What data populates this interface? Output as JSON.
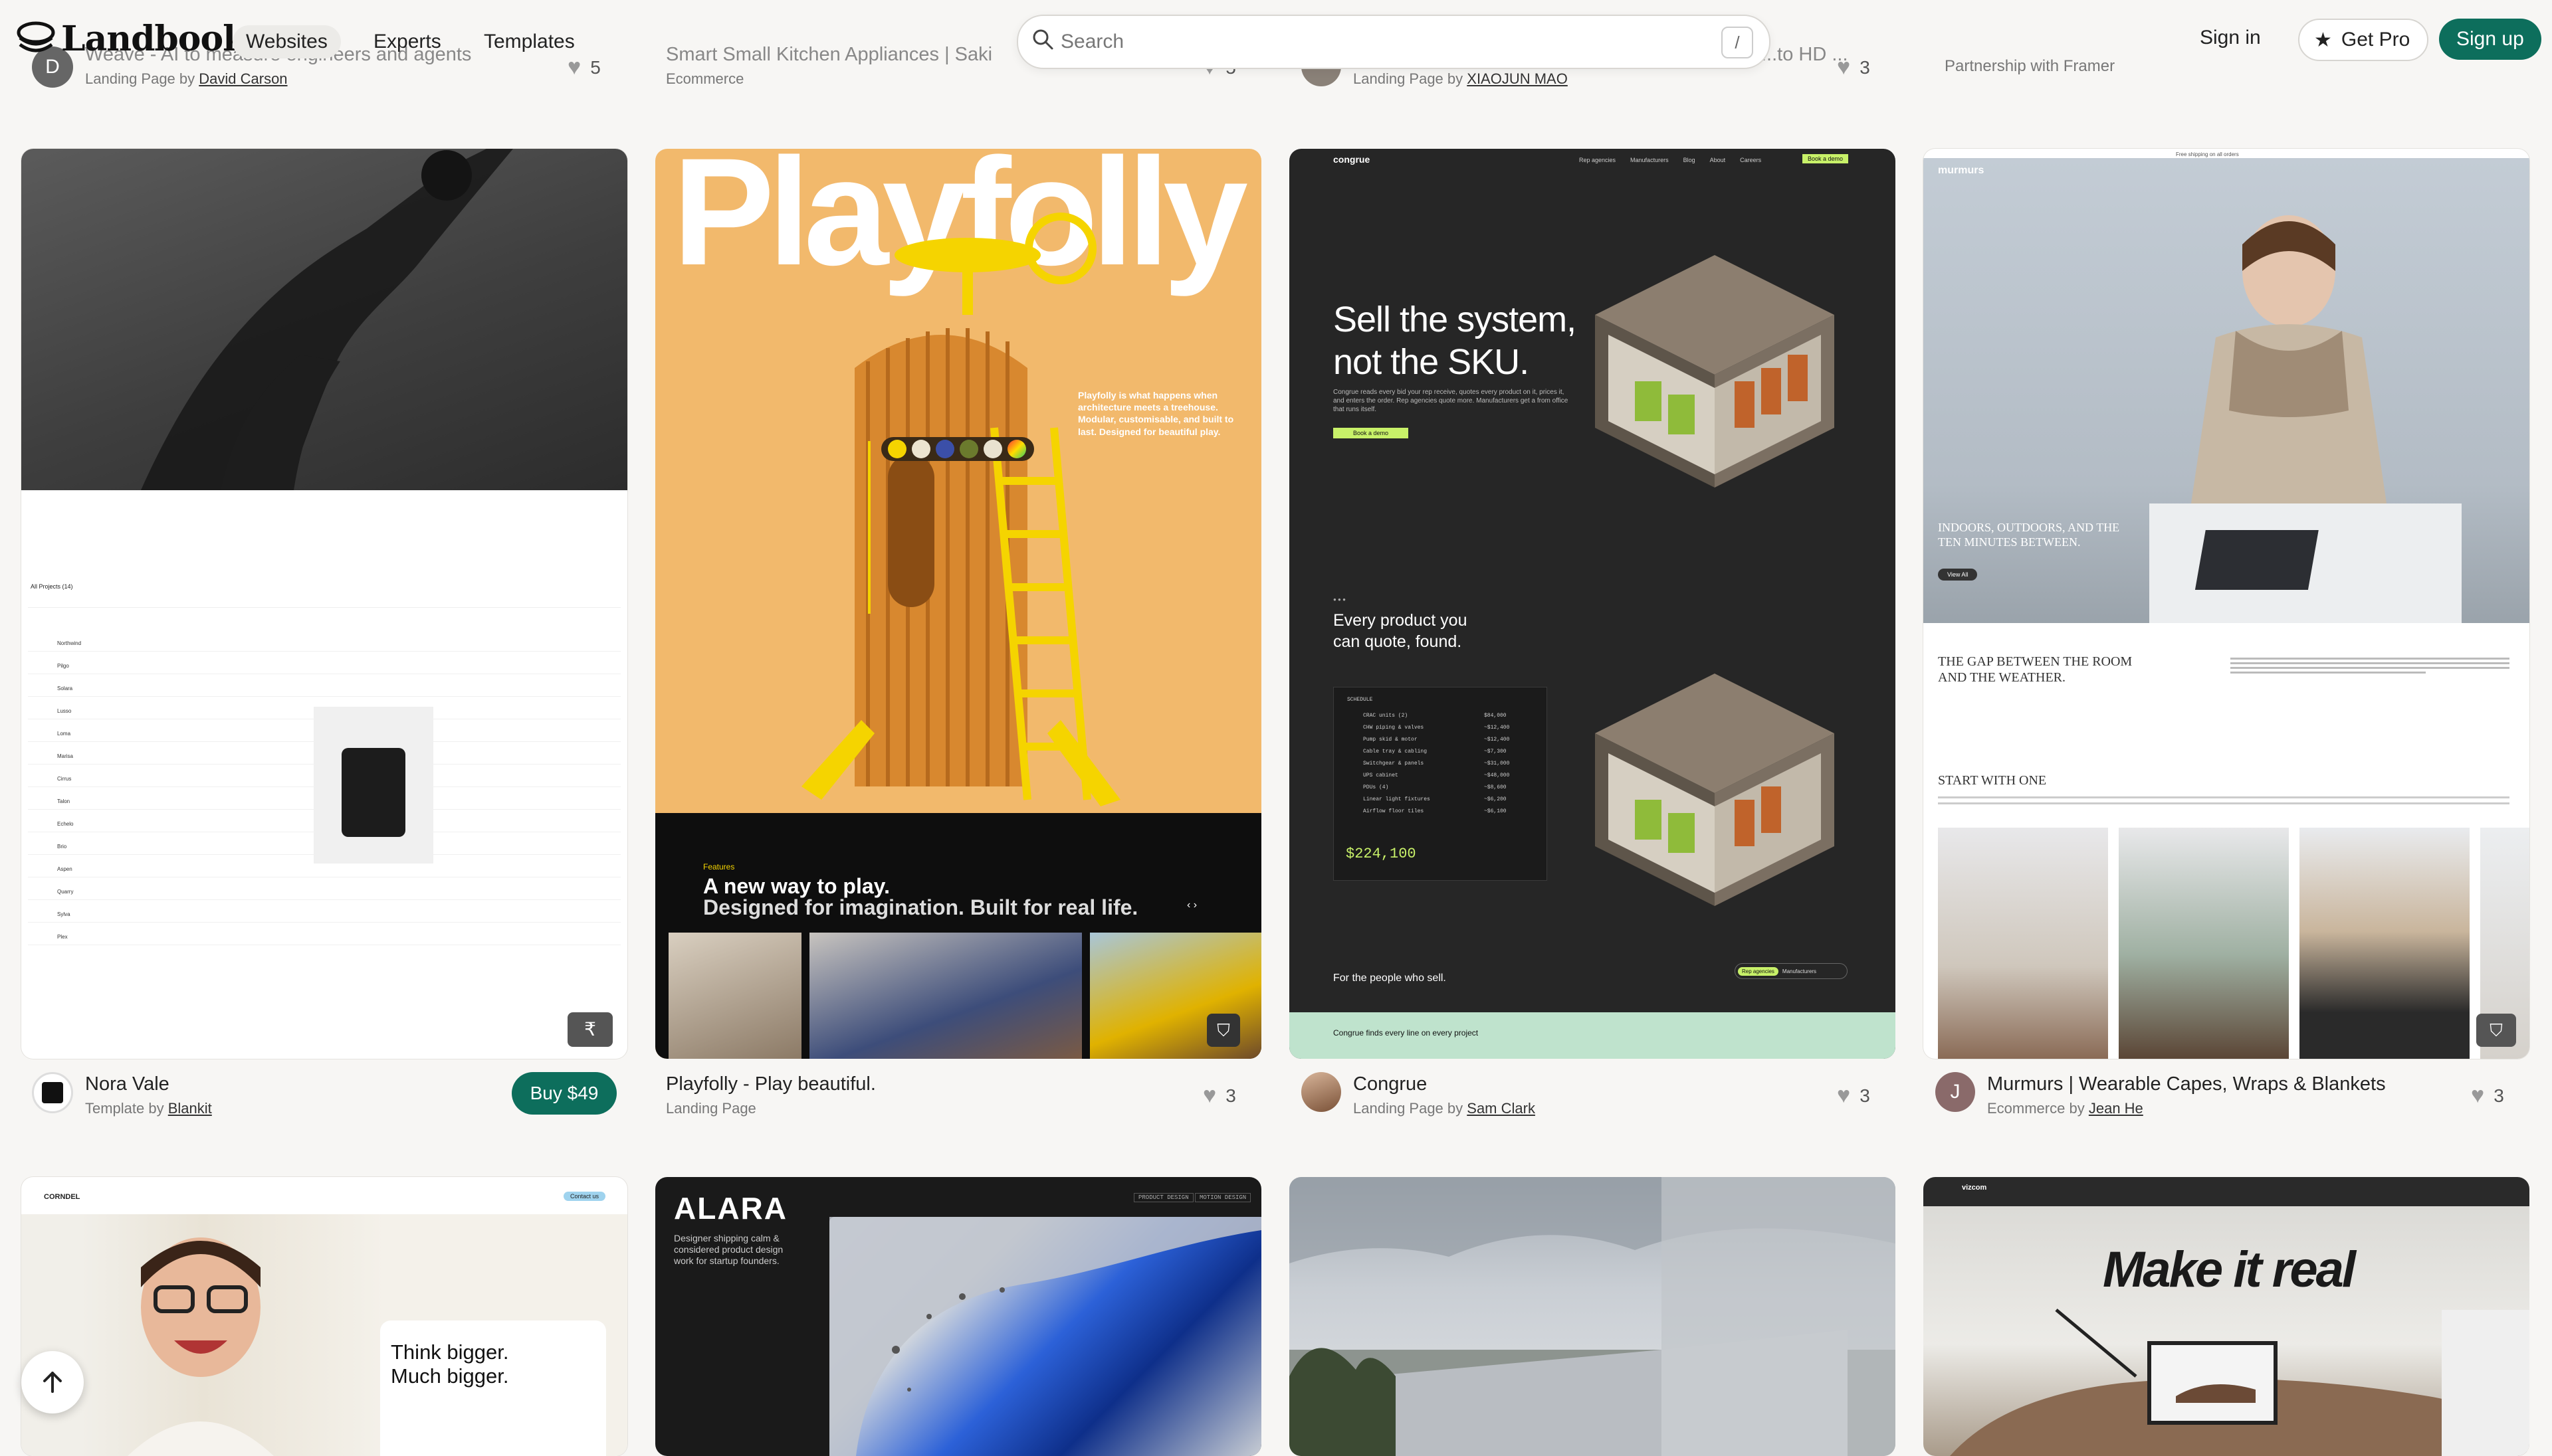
{
  "header": {
    "logo": "Landbook",
    "nav": [
      "Websites",
      "Experts",
      "Templates"
    ],
    "search_placeholder": "Search",
    "search_shortcut": "/",
    "sign_in": "Sign in",
    "get_pro": "Get Pro",
    "sign_up": "Sign up"
  },
  "top_row": [
    {
      "title": "Weave - AI to measure engineers and agents",
      "type": "Landing Page by",
      "author": "David Carson",
      "likes": "5",
      "avatar": "D"
    },
    {
      "title": "Smart Small Kitchen Appliances | Saki",
      "type": "Ecommerce",
      "likes": "5"
    },
    {
      "title": "...to HD ...",
      "type": "Landing Page by",
      "author": "XIAOJUN MAO",
      "likes": "3"
    },
    {
      "title": "",
      "type": "Partnership with Framer"
    }
  ],
  "cards": [
    {
      "title": "Nora Vale",
      "type": "Template by",
      "author": "Blankit",
      "buy": "Buy $49",
      "preview": {
        "projects_label": "All Projects (14)",
        "rows": [
          "Northwind",
          "Pilgo",
          "Solara",
          "Lusso",
          "Loma",
          "Marisa",
          "Cirrus",
          "Talon",
          "Echelo",
          "Brio",
          "Aspen",
          "Quarry",
          "Sylva",
          "Plex"
        ]
      }
    },
    {
      "title": "Playfolly - Play beautiful.",
      "type": "Landing Page",
      "likes": "3",
      "preview": {
        "brand": "Playfolly",
        "blurb": "Playfolly is what happens when architecture meets a treehouse. Modular, customisable, and built to last. Designed for beautiful play.",
        "features": "Features",
        "headline1": "A new way to play.",
        "headline2": "Designed for imagination. Built for real life."
      }
    },
    {
      "title": "Congrue",
      "type": "Landing Page by",
      "author": "Sam Clark",
      "likes": "3",
      "preview": {
        "brand": "congrue",
        "nav": [
          "Rep agencies",
          "Manufacturers",
          "Blog",
          "About",
          "Careers"
        ],
        "nav_cta": "Book a demo",
        "hero1": "Sell the system,",
        "hero2": "not the SKU.",
        "hero_sub": "Congrue reads every bid your rep receive, quotes every product on it, prices it, and enters the order. Rep agencies quote more. Manufacturers get a from office that runs itself.",
        "cta": "Book a demo",
        "section1_a": "Every product you",
        "section1_b": "can quote, found.",
        "schedule_label": "SCHEDULE",
        "schedule": [
          {
            "name": "CRAC units (2)",
            "value": "$84,000"
          },
          {
            "name": "CHW piping & valves",
            "value": "~$12,400"
          },
          {
            "name": "Pump skid & motor",
            "value": "~$12,400"
          },
          {
            "name": "Cable tray & cabling",
            "value": "~$7,300"
          },
          {
            "name": "Switchgear & panels",
            "value": "~$31,000"
          },
          {
            "name": "UPS cabinet",
            "value": "~$48,000"
          },
          {
            "name": "PDUs (4)",
            "value": "~$8,600"
          },
          {
            "name": "Linear light fixtures",
            "value": "~$6,200"
          },
          {
            "name": "Airflow floor tiles",
            "value": "~$6,100"
          }
        ],
        "total": "$224,100",
        "section2": "For the people who sell.",
        "tab1": "Rep agencies",
        "tab2": "Manufacturers",
        "strip": "Congrue finds every line on every project"
      }
    },
    {
      "title": "Murmurs | Wearable Capes, Wraps & Blankets",
      "type": "Ecommerce by",
      "author": "Jean He",
      "likes": "3",
      "avatar": "J",
      "preview": {
        "banner": "Free shipping on all orders",
        "brand": "murmurs",
        "hero_text": "INDOORS, OUTDOORS, AND THE TEN MINUTES BETWEEN.",
        "view_all": "View All",
        "gap_title": "THE GAP BETWEEN THE ROOM AND THE WEATHER.",
        "start_title": "START WITH ONE"
      }
    }
  ],
  "bottom_row": [
    {
      "brand": "CORNDEL",
      "headline1": "Think bigger.",
      "headline2": "Much bigger.",
      "cta": "Contact us"
    },
    {
      "brand": "ALARA",
      "tagline": "Designer shipping calm & considered product design work for startup founders.",
      "tags": [
        "PRODUCT DESIGN",
        "MOTION DESIGN"
      ]
    },
    {
      "brand": ""
    },
    {
      "brand": "vizcom",
      "headline": "Make it real"
    }
  ],
  "colors": {
    "accent": "#0d6e5c",
    "bg": "#f7f6f4",
    "playfolly_bg": "#f2b96c",
    "congrue_bg": "#262626"
  }
}
